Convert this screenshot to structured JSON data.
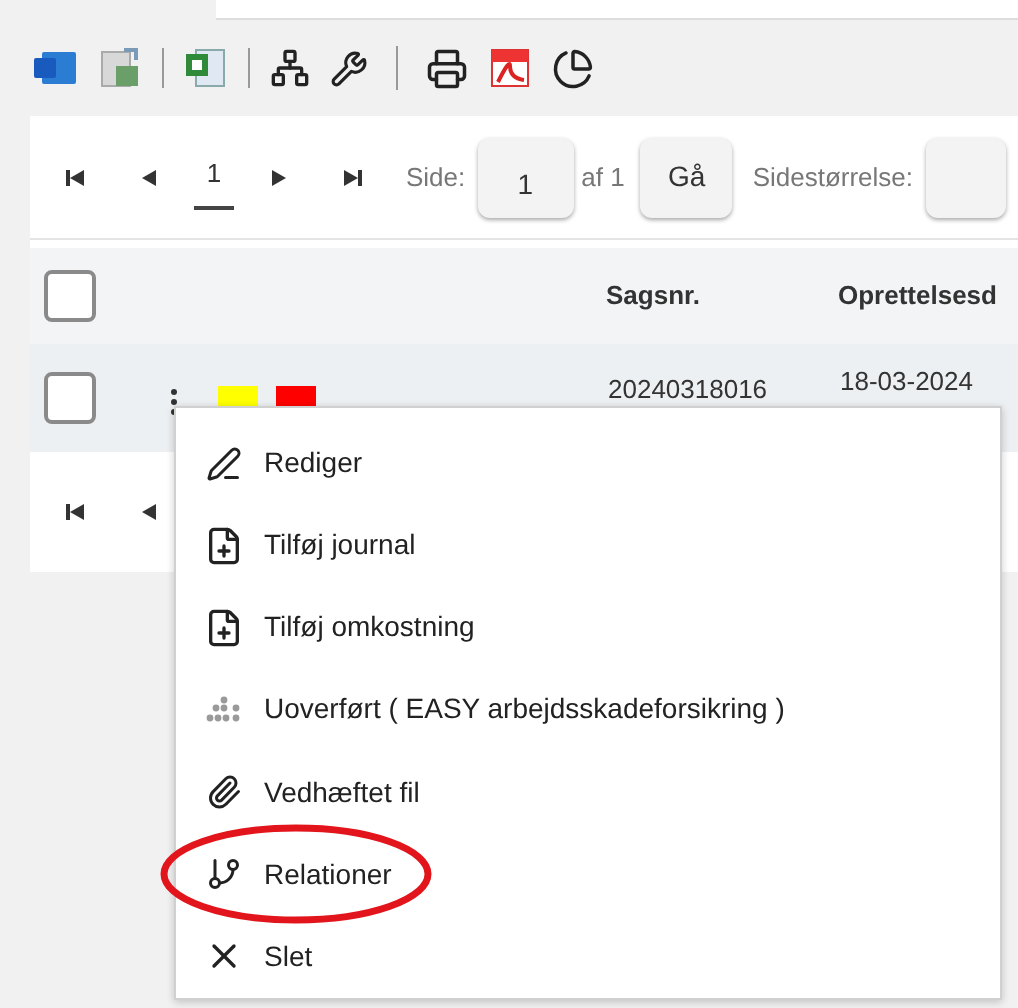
{
  "pager": {
    "current_page": "1",
    "page_label": "Side:",
    "page_value": "1",
    "page_of": "af 1",
    "go_button": "Gå",
    "page_size_label": "Sidestørrelse:"
  },
  "table": {
    "columns": [
      "Sagsnr.",
      "Oprettelsesd"
    ],
    "rows": [
      {
        "checked": false,
        "flags": [
          {
            "color": "#ffff00"
          },
          {
            "color": "#ff0000"
          }
        ],
        "cells": [
          "20240318016",
          "18-03-2024"
        ]
      }
    ],
    "header_checked": false
  },
  "context_menu": {
    "items": [
      {
        "kind": "edit",
        "label": "Rediger",
        "highlighted": false
      },
      {
        "kind": "file-plus",
        "label": "Tilføj journal",
        "highlighted": false
      },
      {
        "kind": "file-plus",
        "label": "Tilføj omkostning",
        "highlighted": false
      },
      {
        "kind": "dots",
        "label": "Uoverført ( EASY arbejdsskadeforsikring )",
        "highlighted": false
      },
      {
        "kind": "paperclip",
        "label": "Vedhæftet fil",
        "highlighted": false
      },
      {
        "kind": "branch",
        "label": "Relationer",
        "highlighted": true
      },
      {
        "kind": "delete",
        "label": "Slet",
        "highlighted": false
      }
    ]
  }
}
